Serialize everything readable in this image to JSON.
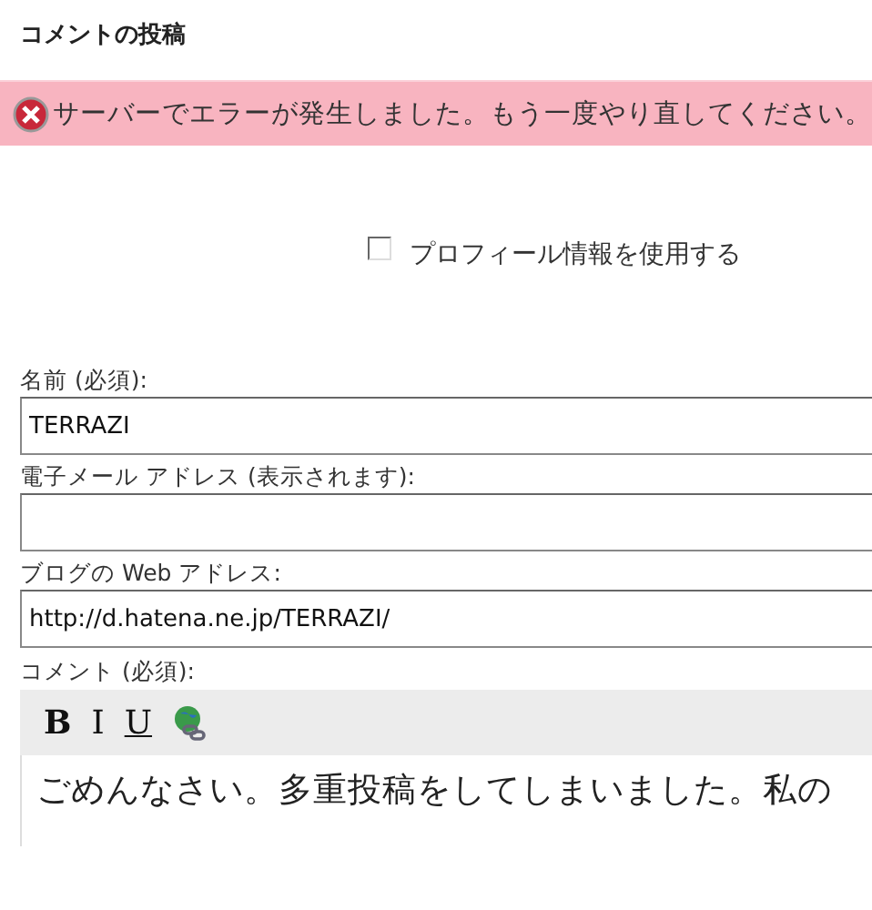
{
  "heading": "コメントの投稿",
  "error": {
    "message": "サーバーでエラーが発生しました。もう一度やり直してください。"
  },
  "profile_option": {
    "label": "プロフィール情報を使用する",
    "checked": false
  },
  "fields": [
    {
      "label": "名前 (必須):",
      "value": "TERRAZI"
    },
    {
      "label": "電子メール アドレス (表示されます):"
    },
    {
      "label": "ブログの Web アドレス:",
      "value": "http://d.hatena.ne.jp/TERRAZI/"
    }
  ],
  "comment": {
    "label": "コメント (必須):",
    "toolbar": [
      {
        "kind": "bold",
        "label": "B"
      },
      {
        "kind": "italic",
        "label": "I"
      },
      {
        "kind": "underline",
        "label": "U"
      },
      {
        "kind": "link"
      }
    ],
    "text": "ごめんなさい。多重投稿をしてしまいました。私の"
  }
}
